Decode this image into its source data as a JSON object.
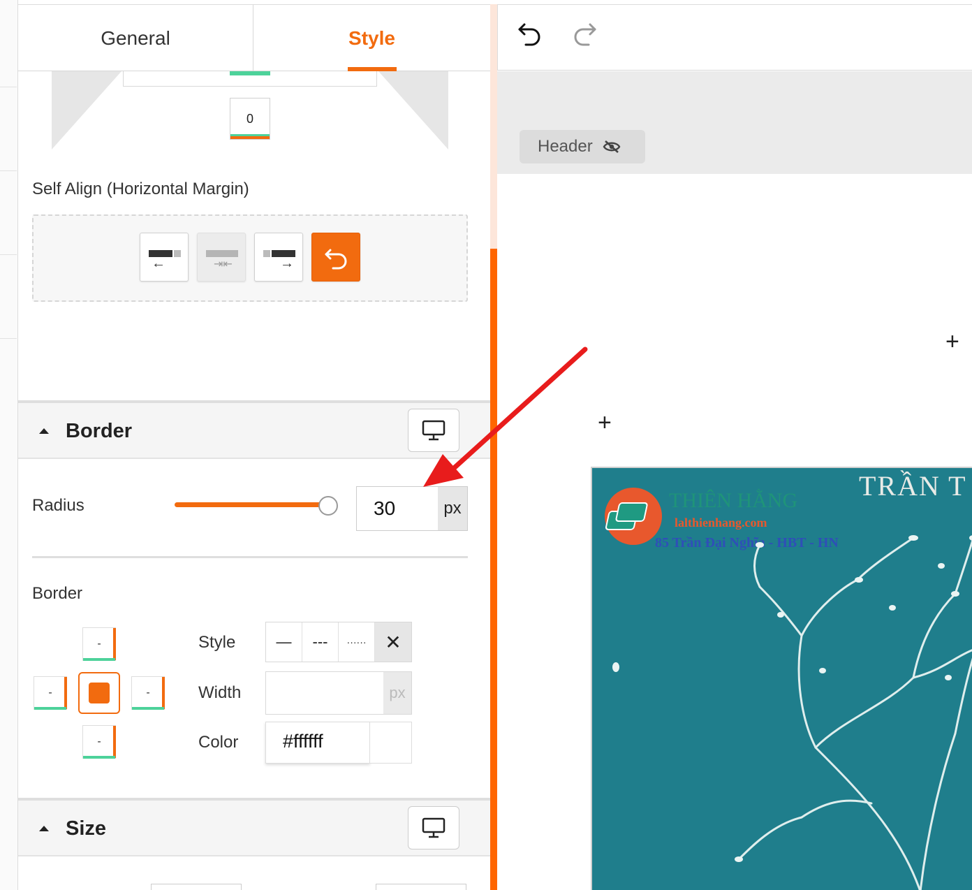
{
  "tabs": {
    "general": "General",
    "style": "Style"
  },
  "spacing": {
    "margin_bottom_value": "0"
  },
  "self_align": {
    "label": "Self Align (Horizontal Margin)",
    "buttons": [
      "align-left",
      "align-center",
      "align-right",
      "reset"
    ]
  },
  "border_section": {
    "title": "Border",
    "radius": {
      "label": "Radius",
      "value": "30",
      "unit": "px",
      "slider_fraction": 1.0
    },
    "border_label": "Border",
    "sides": {
      "top": "-",
      "left": "-",
      "right": "-",
      "bottom": "-"
    },
    "style": {
      "label": "Style",
      "options": [
        "—",
        "---",
        "······",
        "✕"
      ],
      "selected": "✕"
    },
    "width": {
      "label": "Width",
      "value": "",
      "unit": "px"
    },
    "color": {
      "label": "Color",
      "value": "#ffffff"
    }
  },
  "size_section": {
    "title": "Size"
  },
  "canvas": {
    "header_chip": "Header",
    "book": {
      "title": "TRẦN T",
      "brand": "THIÊN HẰNG",
      "site": "lalthienhang.com",
      "address": "85 Trần Đại Nghĩa - HBT - HN"
    }
  },
  "colors": {
    "accent": "#f26b0f",
    "green": "#4dd29a",
    "book_bg": "#1f7e8c",
    "annotation_arrow": "#e81c1c"
  }
}
